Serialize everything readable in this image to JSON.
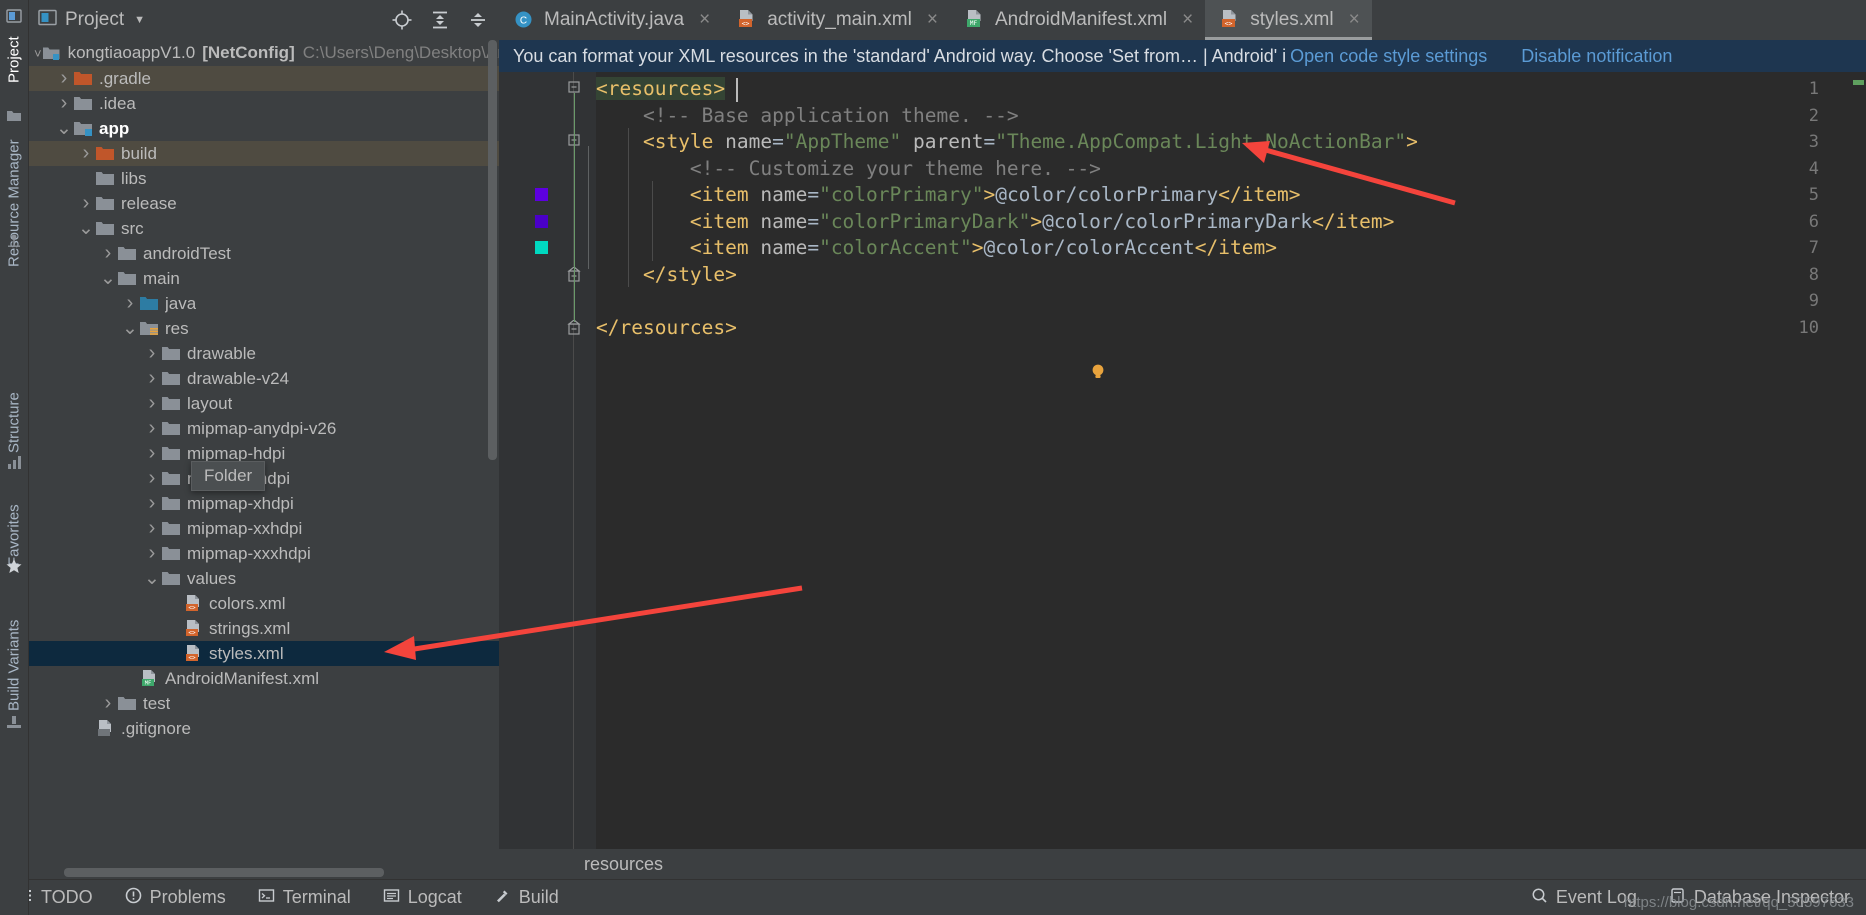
{
  "window": {
    "left_strip_tabs": [
      "Project",
      "Resource Manager",
      "Structure",
      "Favorites",
      "Build Variants"
    ]
  },
  "project_panel": {
    "title": "Project",
    "toolbar_icons": [
      "locate-icon",
      "expand-all-icon",
      "collapse-all-icon",
      "settings-gear-icon",
      "minimize-icon"
    ],
    "root": {
      "name": "kongtiaoappV1.0",
      "config": "[NetConfig]",
      "path": "C:\\Users\\Deng\\Desktop\\An"
    },
    "tooltip": "Folder",
    "tree": [
      {
        "label": ".gradle",
        "depth": 1,
        "arrow": "right",
        "icon": "folder-excluded",
        "state": "excluded"
      },
      {
        "label": ".idea",
        "depth": 1,
        "arrow": "right",
        "icon": "folder",
        "state": "normal"
      },
      {
        "label": "app",
        "depth": 1,
        "arrow": "down",
        "icon": "folder-module",
        "state": "bold"
      },
      {
        "label": "build",
        "depth": 2,
        "arrow": "right",
        "icon": "folder-excluded",
        "state": "excluded"
      },
      {
        "label": "libs",
        "depth": 2,
        "arrow": "none",
        "icon": "folder",
        "state": "normal"
      },
      {
        "label": "release",
        "depth": 2,
        "arrow": "right",
        "icon": "folder",
        "state": "normal"
      },
      {
        "label": "src",
        "depth": 2,
        "arrow": "down",
        "icon": "folder",
        "state": "normal"
      },
      {
        "label": "androidTest",
        "depth": 3,
        "arrow": "right",
        "icon": "folder",
        "state": "normal"
      },
      {
        "label": "main",
        "depth": 3,
        "arrow": "down",
        "icon": "folder",
        "state": "normal"
      },
      {
        "label": "java",
        "depth": 4,
        "arrow": "right",
        "icon": "folder-source",
        "state": "normal"
      },
      {
        "label": "res",
        "depth": 4,
        "arrow": "down",
        "icon": "folder-res",
        "state": "normal"
      },
      {
        "label": "drawable",
        "depth": 5,
        "arrow": "right",
        "icon": "folder",
        "state": "normal"
      },
      {
        "label": "drawable-v24",
        "depth": 5,
        "arrow": "right",
        "icon": "folder",
        "state": "normal"
      },
      {
        "label": "layout",
        "depth": 5,
        "arrow": "right",
        "icon": "folder",
        "state": "normal"
      },
      {
        "label": "mipmap-anydpi-v26",
        "depth": 5,
        "arrow": "right",
        "icon": "folder",
        "state": "normal"
      },
      {
        "label": "mipmap-hdpi",
        "depth": 5,
        "arrow": "right",
        "icon": "folder",
        "state": "normal"
      },
      {
        "label": "mipmap-mdpi",
        "depth": 5,
        "arrow": "right",
        "icon": "folder",
        "state": "normal"
      },
      {
        "label": "mipmap-xhdpi",
        "depth": 5,
        "arrow": "right",
        "icon": "folder",
        "state": "normal"
      },
      {
        "label": "mipmap-xxhdpi",
        "depth": 5,
        "arrow": "right",
        "icon": "folder",
        "state": "normal"
      },
      {
        "label": "mipmap-xxxhdpi",
        "depth": 5,
        "arrow": "right",
        "icon": "folder",
        "state": "normal"
      },
      {
        "label": "values",
        "depth": 5,
        "arrow": "down",
        "icon": "folder",
        "state": "normal"
      },
      {
        "label": "colors.xml",
        "depth": 6,
        "arrow": "none",
        "icon": "file-xml",
        "state": "normal"
      },
      {
        "label": "strings.xml",
        "depth": 6,
        "arrow": "none",
        "icon": "file-xml",
        "state": "normal"
      },
      {
        "label": "styles.xml",
        "depth": 6,
        "arrow": "none",
        "icon": "file-xml",
        "state": "selected"
      },
      {
        "label": "AndroidManifest.xml",
        "depth": 4,
        "arrow": "none",
        "icon": "file-manifest",
        "state": "normal"
      },
      {
        "label": "test",
        "depth": 3,
        "arrow": "right",
        "icon": "folder",
        "state": "normal"
      },
      {
        "label": ".gitignore",
        "depth": 2,
        "arrow": "none",
        "icon": "file-gitignore",
        "state": "normal"
      }
    ]
  },
  "editor": {
    "tabs": [
      {
        "label": "MainActivity.java",
        "icon": "java-class-icon",
        "active": false,
        "closable": true
      },
      {
        "label": "activity_main.xml",
        "icon": "xml-layout-icon",
        "active": false,
        "closable": true
      },
      {
        "label": "AndroidManifest.xml",
        "icon": "xml-manifest-icon",
        "active": false,
        "closable": true
      },
      {
        "label": "styles.xml",
        "icon": "xml-values-icon",
        "active": true,
        "closable": true
      }
    ],
    "notification": {
      "message": "You can format your XML resources in the 'standard' Android way. Choose 'Set from… | Android' i",
      "link": "Open code style settings",
      "disable_link": "Disable notification"
    },
    "breadcrumb": "resources",
    "lines": [
      {
        "n": 1,
        "swatch": null,
        "fold": "start",
        "tokens": [
          {
            "t": "<resources>",
            "c": "tagname hl-res"
          }
        ]
      },
      {
        "n": 2,
        "swatch": null,
        "fold": null,
        "tokens": [
          {
            "t": "    ",
            "c": "txt"
          },
          {
            "t": "<!-- Base application theme. -->",
            "c": "cmt"
          }
        ]
      },
      {
        "n": 3,
        "swatch": null,
        "fold": "start",
        "tokens": [
          {
            "t": "    ",
            "c": "txt"
          },
          {
            "t": "<style",
            "c": "tagname"
          },
          {
            "t": " name",
            "c": "attrname"
          },
          {
            "t": "=",
            "c": "eq"
          },
          {
            "t": "\"AppTheme\"",
            "c": "attrval"
          },
          {
            "t": " parent",
            "c": "attrname"
          },
          {
            "t": "=",
            "c": "eq"
          },
          {
            "t": "\"Theme.AppCompat.Light.NoActionBar\"",
            "c": "attrval"
          },
          {
            "t": ">",
            "c": "tagname"
          }
        ]
      },
      {
        "n": 4,
        "swatch": null,
        "fold": null,
        "tokens": [
          {
            "t": "        ",
            "c": "txt"
          },
          {
            "t": "<!-- Customize your theme here. -->",
            "c": "cmt"
          }
        ]
      },
      {
        "n": 5,
        "swatch": "#5d00e0",
        "fold": null,
        "tokens": [
          {
            "t": "        ",
            "c": "txt"
          },
          {
            "t": "<item",
            "c": "tagname"
          },
          {
            "t": " name",
            "c": "attrname"
          },
          {
            "t": "=",
            "c": "eq"
          },
          {
            "t": "\"colorPrimary\"",
            "c": "attrval"
          },
          {
            "t": ">",
            "c": "tagname"
          },
          {
            "t": "@color/colorPrimary",
            "c": "txt"
          },
          {
            "t": "</item>",
            "c": "tagname"
          }
        ]
      },
      {
        "n": 6,
        "swatch": "#4a00c8",
        "fold": null,
        "tokens": [
          {
            "t": "        ",
            "c": "txt"
          },
          {
            "t": "<item",
            "c": "tagname"
          },
          {
            "t": " name",
            "c": "attrname"
          },
          {
            "t": "=",
            "c": "eq"
          },
          {
            "t": "\"colorPrimaryDark\"",
            "c": "attrval"
          },
          {
            "t": ">",
            "c": "tagname"
          },
          {
            "t": "@color/colorPrimaryDark",
            "c": "txt"
          },
          {
            "t": "</item>",
            "c": "tagname"
          }
        ]
      },
      {
        "n": 7,
        "swatch": "#00d9c0",
        "fold": null,
        "tokens": [
          {
            "t": "        ",
            "c": "txt"
          },
          {
            "t": "<item",
            "c": "tagname"
          },
          {
            "t": " name",
            "c": "attrname"
          },
          {
            "t": "=",
            "c": "eq"
          },
          {
            "t": "\"colorAccent\"",
            "c": "attrval"
          },
          {
            "t": ">",
            "c": "tagname"
          },
          {
            "t": "@color/colorAccent",
            "c": "txt"
          },
          {
            "t": "</item>",
            "c": "tagname"
          }
        ]
      },
      {
        "n": 8,
        "swatch": null,
        "fold": "end",
        "tokens": [
          {
            "t": "    ",
            "c": "txt"
          },
          {
            "t": "</style>",
            "c": "tagname"
          }
        ]
      },
      {
        "n": 9,
        "swatch": null,
        "fold": null,
        "tokens": [
          {
            "t": "",
            "c": "txt"
          }
        ]
      },
      {
        "n": 10,
        "swatch": null,
        "fold": "end",
        "tokens": [
          {
            "t": "</resources>",
            "c": "tagname"
          }
        ]
      }
    ],
    "bulb_line": 9
  },
  "status_bar": {
    "left_items": [
      {
        "label": "TODO",
        "icon": "todo-icon"
      },
      {
        "label": "Problems",
        "icon": "problems-icon"
      },
      {
        "label": "Terminal",
        "icon": "terminal-icon"
      },
      {
        "label": "Logcat",
        "icon": "logcat-icon"
      },
      {
        "label": "Build",
        "icon": "build-icon"
      }
    ],
    "right_items": [
      {
        "label": "Event Log",
        "icon": "event-log-icon"
      },
      {
        "label": "Database Inspector",
        "icon": "database-icon"
      }
    ]
  },
  "watermark": "https://blog.csdn.net/qq_50597633",
  "colors": {
    "panel_bg": "#3c3f41",
    "editor_bg": "#2b2b2b",
    "gutter_bg": "#313335",
    "selection_blue": "#0d293e",
    "notification_blue": "#1e3650",
    "excluded_olive": "#4f4b41",
    "link_blue": "#5b9bd5",
    "annotation_red": "#f4443c"
  }
}
